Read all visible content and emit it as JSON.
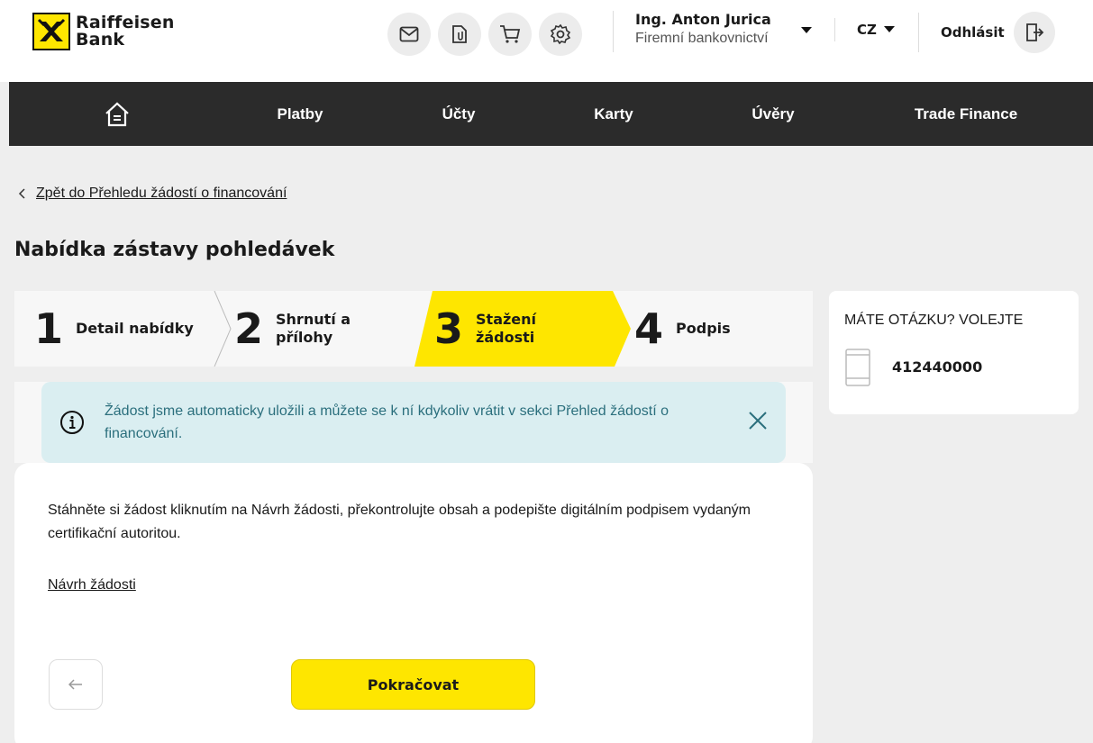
{
  "header": {
    "logo_line1": "Raiffeisen",
    "logo_line2": "Bank",
    "icons": [
      "mail-icon",
      "attachment-icon",
      "cart-icon",
      "settings-icon"
    ],
    "user_name": "Ing. Anton Jurica",
    "user_role": "Firemní bankovnictví",
    "language": "CZ",
    "logout_label": "Odhlásit"
  },
  "nav": {
    "items": [
      "Platby",
      "Účty",
      "Karty",
      "Úvěry",
      "Trade Finance"
    ]
  },
  "back_link": "Zpět do Přehledu žádostí o financování",
  "page_title": "Nabídka zástavy pohledávek",
  "stepper": {
    "steps": [
      {
        "num": "1",
        "label": "Detail nabídky"
      },
      {
        "num": "2",
        "label": "Shrnutí a přílohy"
      },
      {
        "num": "3",
        "label": "Stažení žádosti"
      },
      {
        "num": "4",
        "label": "Podpis"
      }
    ],
    "active_index": 3
  },
  "help": {
    "title": "MÁTE OTÁZKU? VOLEJTE",
    "phone": "412440000"
  },
  "banner": {
    "text": "Žádost jsme automaticky uložili a můžete se k ní kdykoliv vrátit v sekci  Přehled žádostí o financování."
  },
  "card": {
    "instructions": "Stáhněte si žádost kliknutím na Návrh žádosti, překontrolujte obsah a podepište digitálním podpisem vydaným certifikační autoritou.",
    "link": "Návrh žádosti",
    "continue_label": "Pokračovat"
  },
  "colors": {
    "brand_yellow": "#fee600",
    "nav_bg": "#2b2b2b",
    "banner_bg": "#daeef1",
    "banner_text": "#2b6f7d"
  }
}
